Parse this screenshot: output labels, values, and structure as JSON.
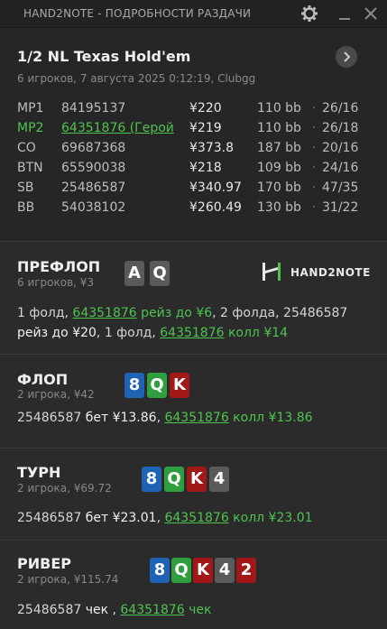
{
  "window": {
    "title": "HAND2NOTE - ПОДРОБНОСТИ РАЗДАЧИ"
  },
  "hand": {
    "game": "1/2 NL Texas Hold'em",
    "subtitle": "6 игроков, 7 августа 2025 0:12:19, Clubgg"
  },
  "players": [
    {
      "pos": "MP1",
      "id": "84195137",
      "stack": "¥220",
      "bb": "110 bb",
      "dot": "·",
      "vpip": "26/16",
      "hero": false
    },
    {
      "pos": "MP2",
      "id": "64351876 (Герой",
      "stack": "¥219",
      "bb": "110 bb",
      "dot": "·",
      "vpip": "26/18",
      "hero": true
    },
    {
      "pos": "CO",
      "id": "69687368",
      "stack": "¥373.8",
      "bb": "187 bb",
      "dot": "·",
      "vpip": "20/16",
      "hero": false
    },
    {
      "pos": "BTN",
      "id": "65590038",
      "stack": "¥218",
      "bb": "109 bb",
      "dot": "·",
      "vpip": "24/16",
      "hero": false
    },
    {
      "pos": "SB",
      "id": "25486587",
      "stack": "¥340.97",
      "bb": "170 bb",
      "dot": "·",
      "vpip": "47/35",
      "hero": false
    },
    {
      "pos": "BB",
      "id": "54038102",
      "stack": "¥260.49",
      "bb": "130 bb",
      "dot": "·",
      "vpip": "31/22",
      "hero": false
    }
  ],
  "logo": {
    "text": "HAND2NOTE"
  },
  "colors": {
    "green": "#4fc34f",
    "spade": "#5a5a5a",
    "club": "#2e9e3e",
    "diamond": "#1f63b5",
    "heart": "#a01818"
  },
  "streets": {
    "preflop": {
      "name": "ПРЕФЛОП",
      "sub": "6 игроков, ¥3",
      "cards": [
        {
          "rank": "A",
          "suit": "spade"
        },
        {
          "rank": "Q",
          "suit": "spade"
        }
      ],
      "line1": [
        "1 фолд, ",
        "64351876",
        " рейз до ¥6",
        ", 2 фолда, 25486587"
      ],
      "line2": [
        "рейз до ¥20",
        ", 1 фолд, ",
        "64351876",
        " колл ¥14"
      ]
    },
    "flop": {
      "name": "ФЛОП",
      "sub": "2 игрока, ¥42",
      "cards": [
        {
          "rank": "8",
          "suit": "diamond"
        },
        {
          "rank": "Q",
          "suit": "club"
        },
        {
          "rank": "K",
          "suit": "heart"
        }
      ],
      "line": [
        "25486587 ",
        "бет ¥13.86",
        ", ",
        "64351876",
        " колл ¥13.86"
      ]
    },
    "turn": {
      "name": "ТУРН",
      "sub": "2 игрока, ¥69.72",
      "cards": [
        {
          "rank": "8",
          "suit": "diamond"
        },
        {
          "rank": "Q",
          "suit": "club"
        },
        {
          "rank": "K",
          "suit": "heart"
        },
        {
          "rank": "4",
          "suit": "spade"
        }
      ],
      "line": [
        "25486587 ",
        "бет ¥23.01",
        ", ",
        "64351876",
        " колл ¥23.01"
      ]
    },
    "river": {
      "name": "РИВЕР",
      "sub": "2 игрока, ¥115.74",
      "cards": [
        {
          "rank": "8",
          "suit": "diamond"
        },
        {
          "rank": "Q",
          "suit": "club"
        },
        {
          "rank": "K",
          "suit": "heart"
        },
        {
          "rank": "4",
          "suit": "spade"
        },
        {
          "rank": "2",
          "suit": "heart"
        }
      ],
      "line": [
        "25486587 ",
        "чек",
        " , ",
        "64351876",
        " чек"
      ]
    }
  }
}
